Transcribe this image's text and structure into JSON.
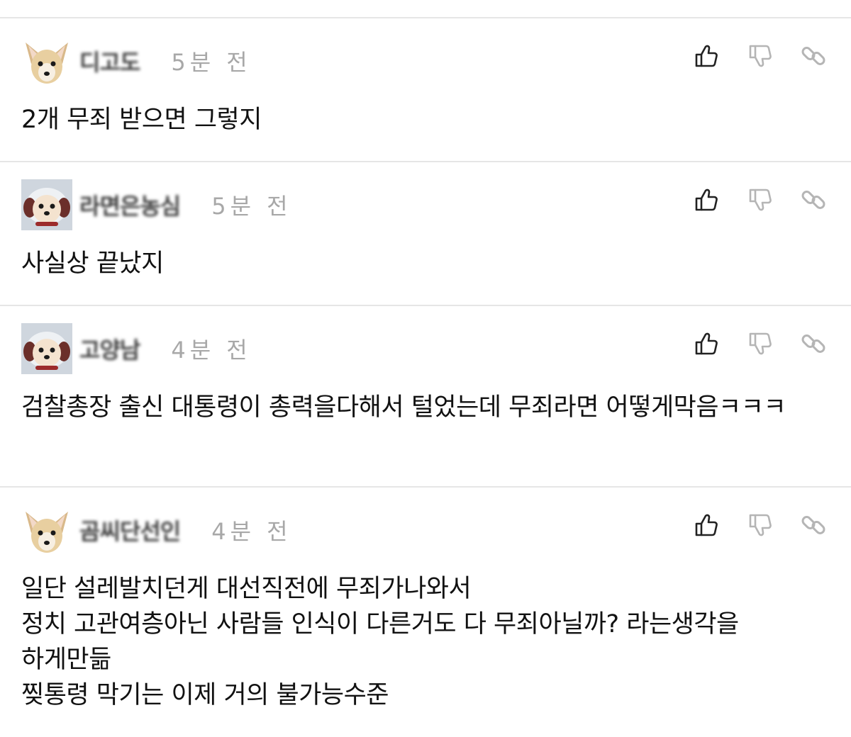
{
  "comments": [
    {
      "nickname": "디고도",
      "time": "5분 전",
      "text": "2개 무죄 받으면 그렇지",
      "avatar_icon": "chihuahua-avatar-icon"
    },
    {
      "nickname": "라면은농심",
      "time": "5분 전",
      "text": "사실상 끝났지",
      "avatar_icon": "puppy-avatar-icon"
    },
    {
      "nickname": "고양남",
      "time": "4분 전",
      "text": "검찰총장 출신 대통령이 총력을다해서 털었는데 무죄라면 어떻게막음ㅋㅋㅋ",
      "avatar_icon": "puppy-avatar-icon"
    },
    {
      "nickname": "곰씨단선인",
      "time": "4분 전",
      "text": "일단 설레발치던게 대선직전에 무죄가나와서\n정치 고관여층아닌 사람들 인식이 다른거도 다 무죄아닐까? 라는생각을\n하게만듦\n찢통령 막기는 이제 거의 불가능수준",
      "avatar_icon": "chihuahua-avatar-icon"
    }
  ],
  "action_icons": [
    "thumbs-up-icon",
    "thumbs-down-icon",
    "link-icon"
  ],
  "colors": {
    "divider": "#e6e6e6",
    "time": "#a8a8a8",
    "text": "#111111",
    "icon_active": "#222222",
    "icon_muted": "#b5b5b5"
  }
}
